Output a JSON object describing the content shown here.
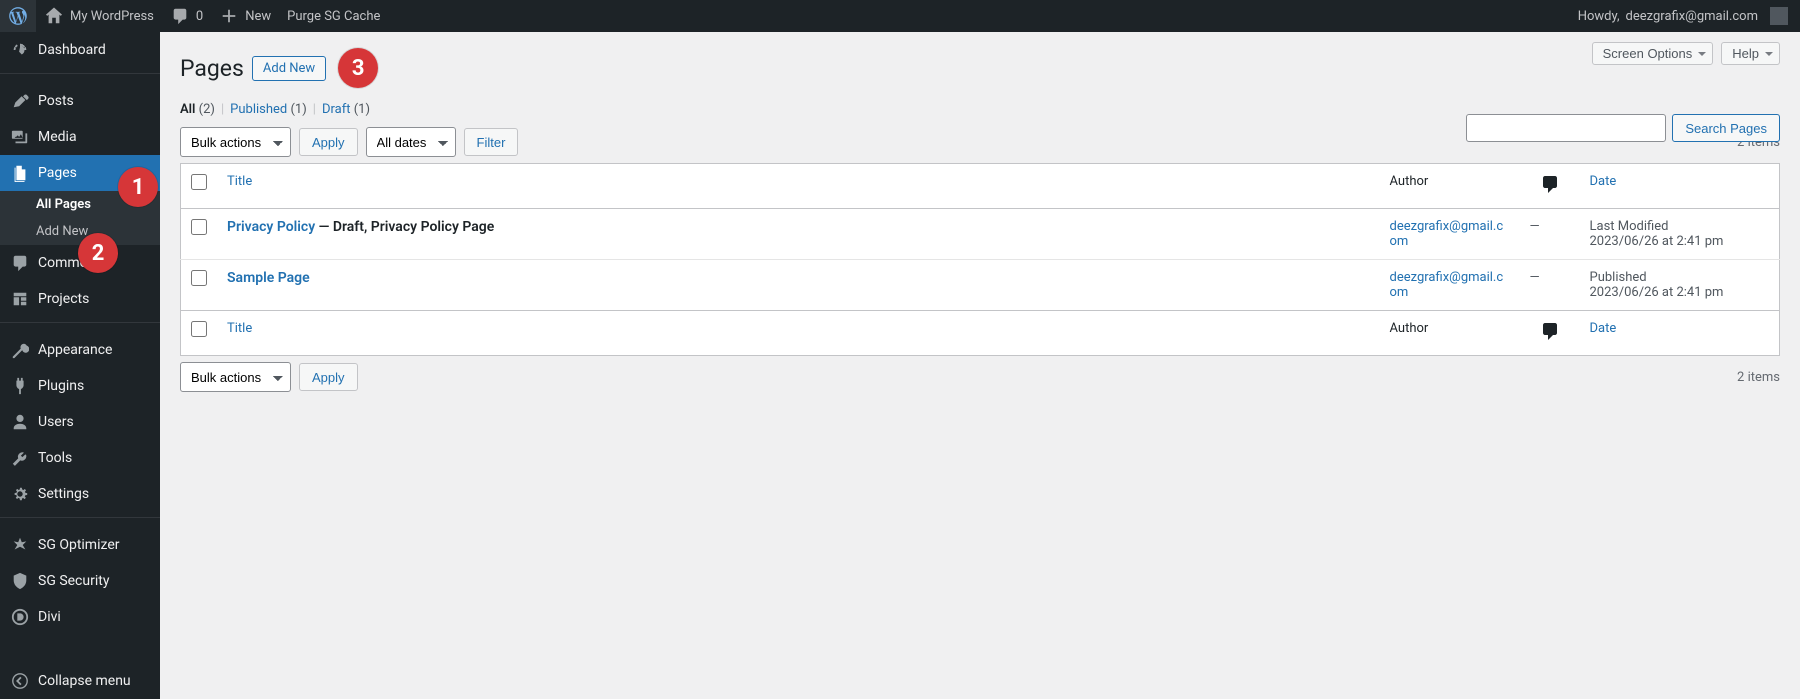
{
  "adminbar": {
    "site": "My WordPress",
    "comments": "0",
    "new": "New",
    "purge": "Purge SG Cache",
    "howdy_prefix": "Howdy, ",
    "howdy_user": "deezgrafix@gmail.com"
  },
  "menu": {
    "dashboard": "Dashboard",
    "posts": "Posts",
    "media": "Media",
    "pages": "Pages",
    "pages_sub_all": "All Pages",
    "pages_sub_add": "Add New",
    "comments": "Comments",
    "projects": "Projects",
    "appearance": "Appearance",
    "plugins": "Plugins",
    "users": "Users",
    "tools": "Tools",
    "settings": "Settings",
    "sg_optimizer": "SG Optimizer",
    "sg_security": "SG Security",
    "divi": "Divi",
    "collapse": "Collapse menu"
  },
  "annotations": {
    "a1": "1",
    "a2": "2",
    "a3": "3"
  },
  "header": {
    "screen_options": "Screen Options",
    "help": "Help",
    "title": "Pages",
    "add_new": "Add New"
  },
  "filters": {
    "all_label": "All ",
    "all_count": "(2)",
    "published_label": "Published ",
    "published_count": "(1)",
    "draft_label": "Draft ",
    "draft_count": "(1)",
    "sep": "|"
  },
  "search": {
    "button": "Search Pages"
  },
  "bulk": {
    "bulk_actions": "Bulk actions",
    "apply": "Apply",
    "all_dates": "All dates",
    "filter": "Filter"
  },
  "count": {
    "items": "2 items"
  },
  "table": {
    "col_title": "Title",
    "col_author": "Author",
    "col_date": "Date",
    "rows": [
      {
        "title": "Privacy Policy",
        "state": " — Draft, Privacy Policy Page",
        "author": "deezgrafix@gmail.com",
        "comments": "—",
        "date_line1": "Last Modified",
        "date_line2": "2023/06/26 at 2:41 pm"
      },
      {
        "title": "Sample Page",
        "state": "",
        "author": "deezgrafix@gmail.com",
        "comments": "—",
        "date_line1": "Published",
        "date_line2": "2023/06/26 at 2:41 pm"
      }
    ]
  }
}
